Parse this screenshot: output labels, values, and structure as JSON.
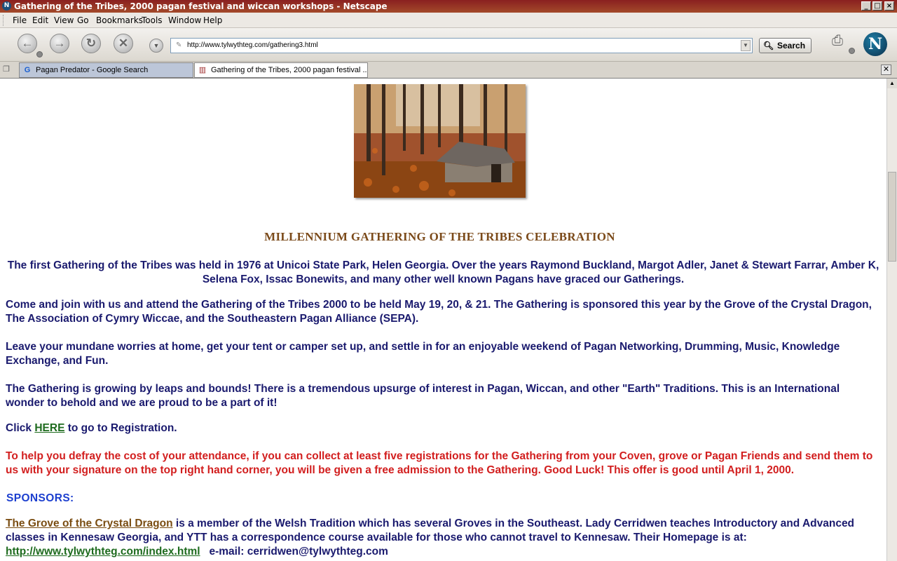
{
  "window": {
    "title": "Gathering of the Tribes, 2000 pagan festival and wiccan workshops - Netscape",
    "buttons": [
      "_",
      "□",
      "×"
    ]
  },
  "menu": [
    "File",
    "Edit",
    "View",
    "Go",
    "Bookmarks",
    "Tools",
    "Window",
    "Help"
  ],
  "nav": {
    "back_glyph": "←",
    "forward_glyph": "→",
    "reload_glyph": "↻",
    "stop_glyph": "✕",
    "url": "http://www.tylwythteg.com/gathering3.html",
    "search_label": "Search"
  },
  "tabs": [
    {
      "label": "Pagan Predator - Google Search",
      "favicon": "google-favicon"
    },
    {
      "label": "Gathering of the Tribes, 2000 pagan festival ...",
      "favicon": "page-favicon"
    }
  ],
  "page": {
    "heading": "MILLENNIUM GATHERING OF THE TRIBES CELEBRATION",
    "p1": "The first Gathering of the Tribes was held in 1976 at Unicoi State Park, Helen Georgia.  Over the years  Raymond Buckland, Margot Adler, Janet & Stewart Farrar, Amber K, Selena Fox, Issac Bonewits, and many other well known Pagans have graced our Gatherings.",
    "p2": "Come and join with us and attend the Gathering of the Tribes 2000 to be held May 19, 20, & 21.  The Gathering is sponsored this year by the Grove of the Crystal Dragon, The Association of Cymry Wiccae, and the Southeastern Pagan Alliance (SEPA).",
    "p3": "Leave your mundane worries at home, get your tent or camper set up, and settle in for an enjoyable weekend of Pagan Networking, Drumming, Music, Knowledge Exchange, and Fun.",
    "p4": "The Gathering is growing by leaps and bounds! There is a tremendous upsurge of interest in Pagan, Wiccan, and other \"Earth\" Traditions. This is an International wonder to behold and we are proud to be a part of it!",
    "click_pre": "Click ",
    "click_link": "HERE",
    "click_post": " to go to Registration.",
    "offer": "To help you defray the cost of your attendance, if you can collect at least five registrations for the Gathering from your Coven, grove or Pagan Friends and send them to us with your signature on the top right hand corner, you will be given a free admission to the Gathering.  Good Luck!  This offer is good until April 1, 2000.",
    "sponsors_label": "SPONSORS:",
    "grove_link": "The Grove of the Crystal Dragon",
    "grove_text": " is a member of the Welsh Tradition which has several Groves in the Southeast. Lady Cerridwen teaches Introductory and Advanced classes in Kennesaw Georgia, and YTT has a correspondence course available for those who cannot travel to Kennesaw. Their Homepage is at:",
    "homepage_link": "http://www.tylwythteg.com/index.html",
    "email_text": "   e-mail: cerridwen@tylwythteg.com"
  },
  "colors": {
    "body_text": "#1a1a6e",
    "heading": "#7b4a1a",
    "offer": "#d21e1e",
    "sponsors": "#1c3fcf",
    "link_green": "#1e6b1e",
    "link_brown": "#7a4d12"
  }
}
